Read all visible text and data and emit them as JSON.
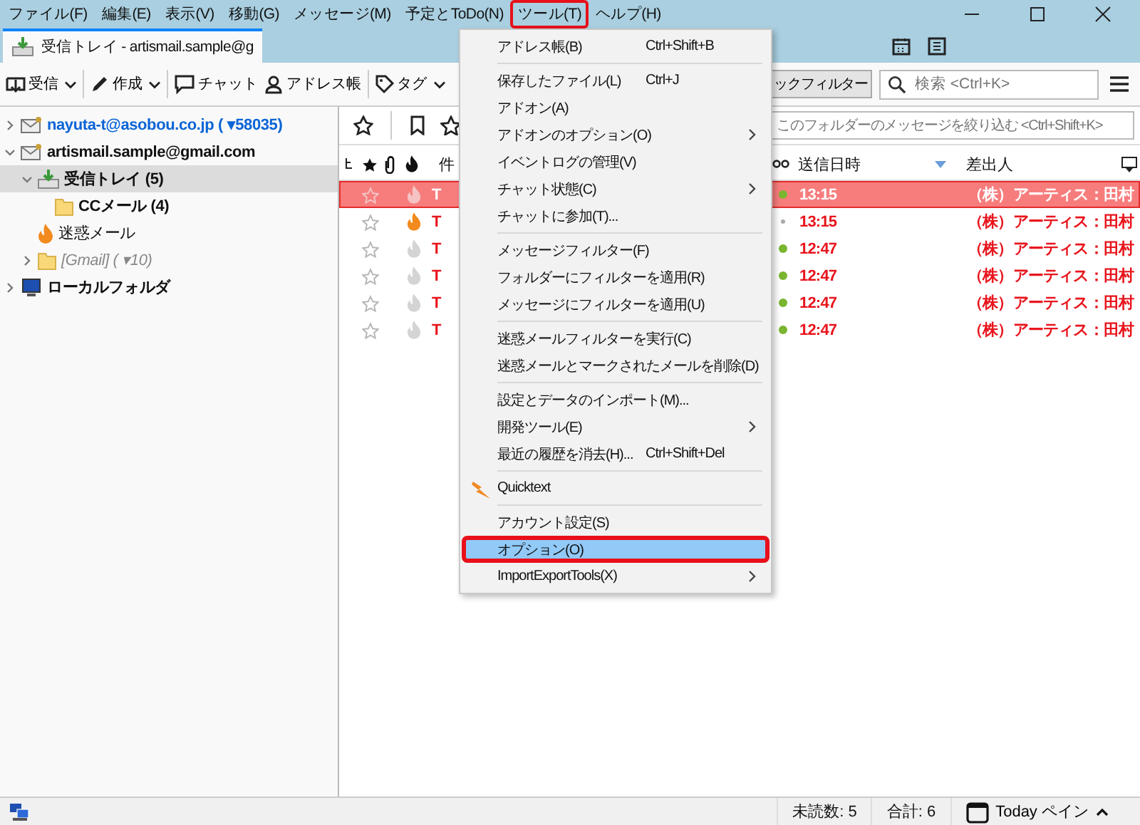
{
  "menubar": [
    {
      "label": "ファイル(F)",
      "selected": false
    },
    {
      "label": "編集(E)",
      "selected": false
    },
    {
      "label": "表示(V)",
      "selected": false
    },
    {
      "label": "移動(G)",
      "selected": false
    },
    {
      "label": "メッセージ(M)",
      "selected": false
    },
    {
      "label": "予定とToDo(N)",
      "selected": false
    },
    {
      "label": "ツール(T)",
      "selected": true
    },
    {
      "label": "ヘルプ(H)",
      "selected": false
    }
  ],
  "tab": {
    "title": "受信トレイ - artismail.sample@g"
  },
  "toolbar": [
    {
      "kind": "get",
      "label": "受信",
      "dropdown": true
    },
    {
      "kind": "write",
      "label": "作成",
      "dropdown": true
    },
    {
      "kind": "chat",
      "label": "チャット",
      "dropdown": false
    },
    {
      "kind": "address",
      "label": "アドレス帳",
      "dropdown": false
    },
    {
      "kind": "tag",
      "label": "タグ",
      "dropdown": true
    }
  ],
  "quick_filter": {
    "label": "ックフィルター"
  },
  "search": {
    "placeholder": "検索 <Ctrl+K>"
  },
  "filter": {
    "placeholder": "このフォルダーのメッセージを絞り込む <Ctrl+Shift+K>"
  },
  "folders": [
    {
      "kind": "account",
      "label": "nayuta-t@asobou.co.jp ( ▾58035)",
      "new_mail": true,
      "unread": true,
      "dimmed": false,
      "expanded": false,
      "selected": false
    },
    {
      "kind": "account",
      "label": "artismail.sample@gmail.com",
      "new_mail": false,
      "unread": true,
      "dimmed": false,
      "expanded": true,
      "selected": false,
      "children": [
        {
          "kind": "inbox",
          "label": "受信トレイ (5)",
          "new_mail": false,
          "unread": true,
          "dimmed": false,
          "expanded": true,
          "selected": true,
          "children": [
            {
              "kind": "folder",
              "label": "CCメール (4)",
              "new_mail": false,
              "unread": true,
              "dimmed": false,
              "selected": false
            }
          ]
        },
        {
          "kind": "junk",
          "label": "迷惑メール",
          "new_mail": false,
          "unread": false,
          "dimmed": false,
          "selected": false
        },
        {
          "kind": "gmail",
          "label": "[Gmail] ( ▾10)",
          "new_mail": false,
          "unread": false,
          "dimmed": true,
          "expanded": false,
          "selected": false
        }
      ]
    },
    {
      "kind": "local",
      "label": "ローカルフォルダ",
      "new_mail": false,
      "unread": true,
      "dimmed": false,
      "expanded": false,
      "selected": false
    }
  ],
  "columns": {
    "subject": "件",
    "date": "送信日時",
    "sender": "差出人"
  },
  "messages": [
    {
      "subject": "T",
      "date": "13:15",
      "sender": "（株）アーティス：田村",
      "selected": true,
      "unread": true,
      "junk": false
    },
    {
      "subject": "T",
      "date": "13:15",
      "sender": "（株）アーティス：田村",
      "selected": false,
      "unread": false,
      "junk": true
    },
    {
      "subject": "T",
      "date": "12:47",
      "sender": "（株）アーティス：田村",
      "selected": false,
      "unread": true,
      "junk": false
    },
    {
      "subject": "T",
      "date": "12:47",
      "sender": "（株）アーティス：田村",
      "selected": false,
      "unread": true,
      "junk": false
    },
    {
      "subject": "T",
      "date": "12:47",
      "sender": "（株）アーティス：田村",
      "selected": false,
      "unread": true,
      "junk": false
    },
    {
      "subject": "T",
      "date": "12:47",
      "sender": "（株）アーティス：田村",
      "selected": false,
      "unread": true,
      "junk": false
    }
  ],
  "tools_menu": [
    {
      "kind": "item",
      "label": "アドレス帳(B)",
      "shortcut": "Ctrl+Shift+B",
      "submenu": false,
      "selected": false
    },
    {
      "kind": "separator"
    },
    {
      "kind": "item",
      "label": "保存したファイル(L)",
      "shortcut": "Ctrl+J",
      "submenu": false,
      "selected": false
    },
    {
      "kind": "item",
      "label": "アドオン(A)",
      "submenu": false,
      "selected": false
    },
    {
      "kind": "item",
      "label": "アドオンのオプション(O)",
      "submenu": true,
      "selected": false
    },
    {
      "kind": "item",
      "label": "イベントログの管理(V)",
      "submenu": false,
      "selected": false
    },
    {
      "kind": "item",
      "label": "チャット状態(C)",
      "submenu": true,
      "selected": false
    },
    {
      "kind": "item",
      "label": "チャットに参加(T)...",
      "submenu": false,
      "selected": false
    },
    {
      "kind": "separator"
    },
    {
      "kind": "item",
      "label": "メッセージフィルター(F)",
      "submenu": false,
      "selected": false
    },
    {
      "kind": "item",
      "label": "フォルダーにフィルターを適用(R)",
      "submenu": false,
      "selected": false
    },
    {
      "kind": "item",
      "label": "メッセージにフィルターを適用(U)",
      "submenu": false,
      "selected": false
    },
    {
      "kind": "separator"
    },
    {
      "kind": "item",
      "label": "迷惑メールフィルターを実行(C)",
      "submenu": false,
      "selected": false
    },
    {
      "kind": "item",
      "label": "迷惑メールとマークされたメールを削除(D)",
      "submenu": false,
      "selected": false
    },
    {
      "kind": "separator"
    },
    {
      "kind": "item",
      "label": "設定とデータのインポート(M)...",
      "submenu": false,
      "selected": false
    },
    {
      "kind": "item",
      "label": "開発ツール(E)",
      "submenu": true,
      "selected": false
    },
    {
      "kind": "item",
      "label": "最近の履歴を消去(H)...",
      "shortcut": "Ctrl+Shift+Del",
      "submenu": false,
      "selected": false
    },
    {
      "kind": "separator"
    },
    {
      "kind": "addon",
      "label": "Quicktext",
      "submenu": false,
      "selected": false
    },
    {
      "kind": "separator"
    },
    {
      "kind": "item",
      "label": "アカウント設定(S)",
      "submenu": false,
      "selected": false
    },
    {
      "kind": "item",
      "label": "オプション(O)",
      "submenu": false,
      "selected": true
    },
    {
      "kind": "item",
      "label": "ImportExportTools(X)",
      "submenu": true,
      "selected": false
    }
  ],
  "status_bar": {
    "unread": "未読数: 5",
    "total": "合計: 6",
    "today_pane": "Today ペイン"
  }
}
